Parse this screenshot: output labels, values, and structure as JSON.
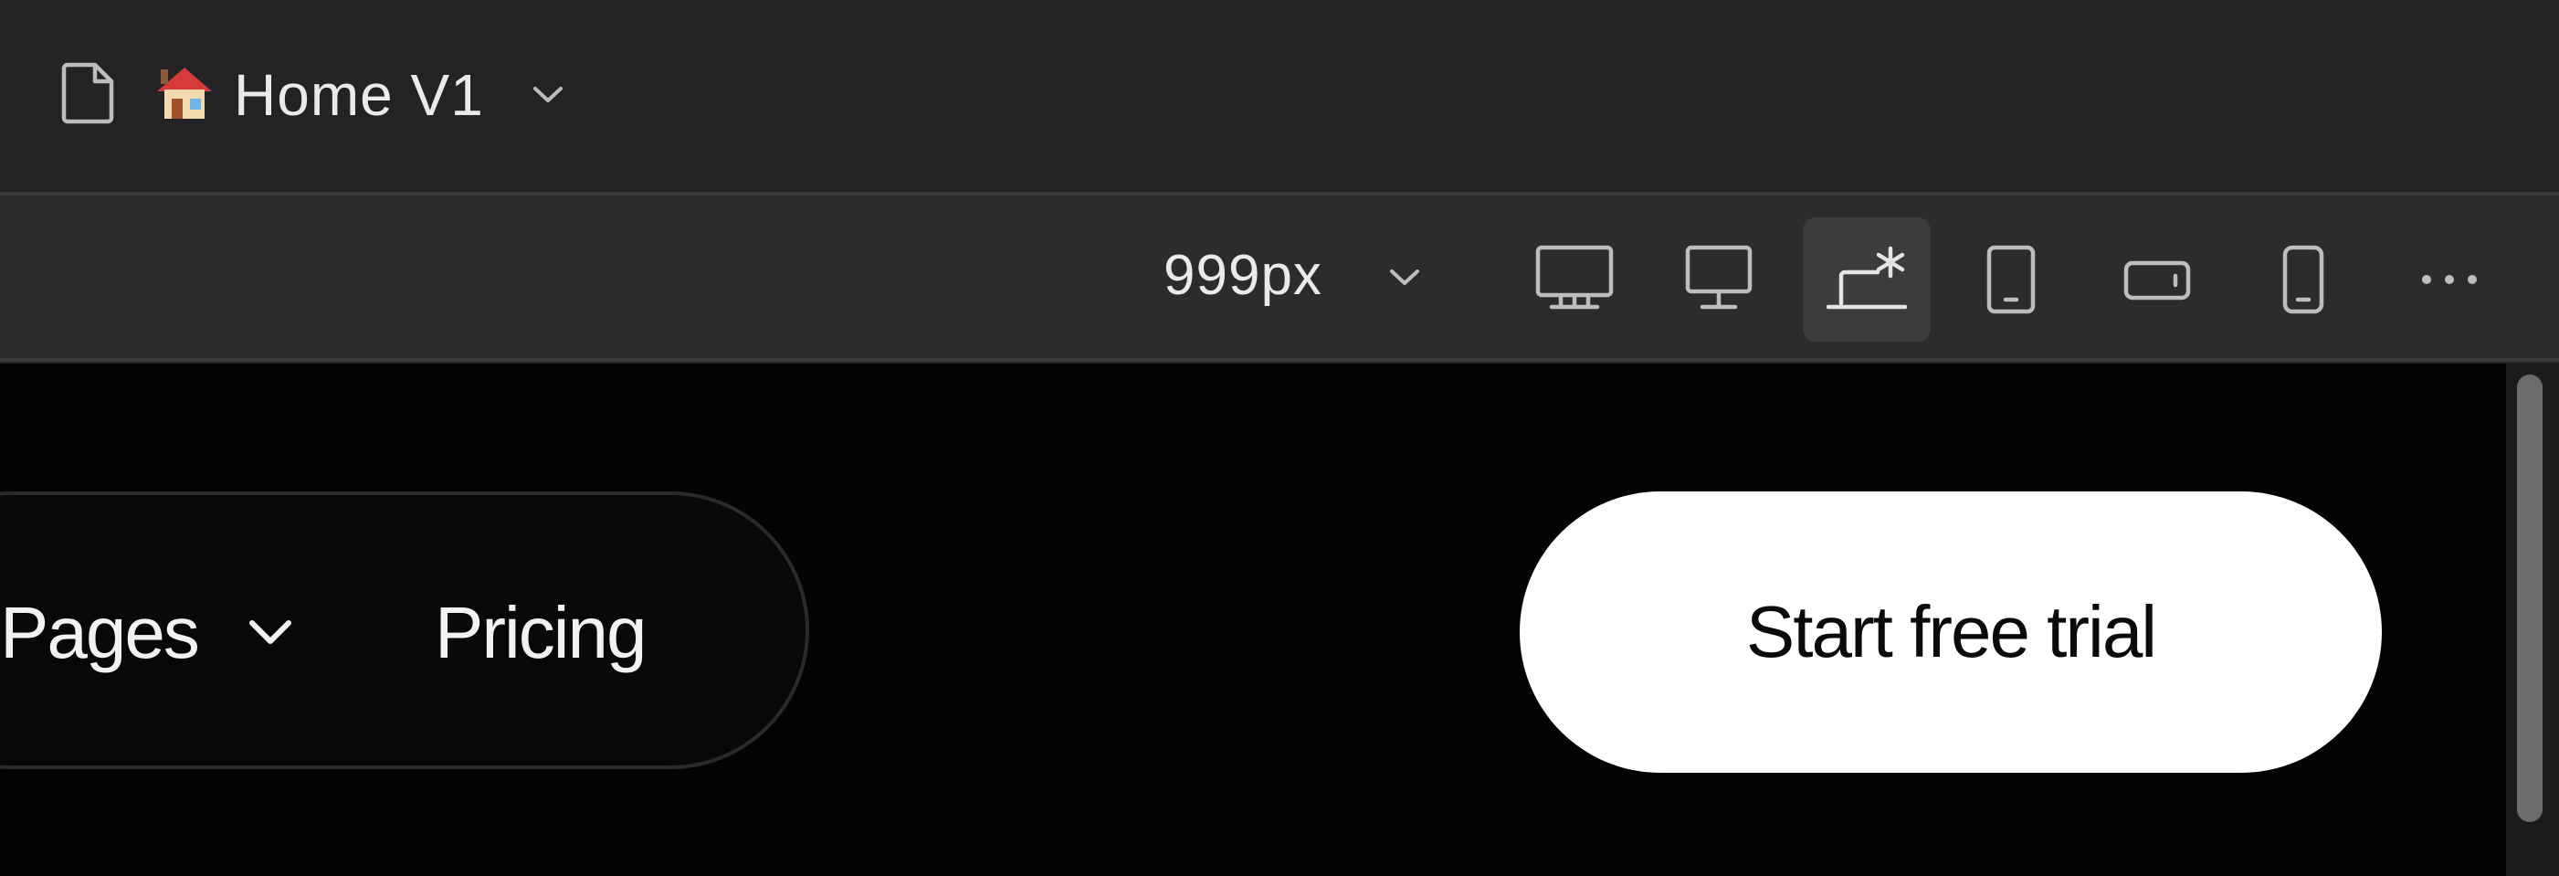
{
  "page_bar": {
    "emoji": "🏠",
    "title": "Home V1",
    "icons": {
      "file": "file-icon",
      "emoji": "house-emoji-icon",
      "dropdown": "chevron-down-icon"
    }
  },
  "toolbar": {
    "width_value": "999px",
    "breakpoints": [
      {
        "icon": "desktop-large-icon",
        "active": false
      },
      {
        "icon": "desktop-icon",
        "active": false
      },
      {
        "icon": "laptop-custom-icon",
        "active": true
      },
      {
        "icon": "tablet-portrait-icon",
        "active": false
      },
      {
        "icon": "tablet-landscape-icon",
        "active": false
      },
      {
        "icon": "phone-icon",
        "active": false
      }
    ],
    "more_icon": "more-horizontal-icon"
  },
  "canvas": {
    "nav": {
      "pages_label": "Pages",
      "pricing_label": "Pricing"
    },
    "cta_label": "Start free trial"
  },
  "colors": {
    "app_bg": "#232325",
    "toolbar_bg": "#2c2c2e",
    "active_button_bg": "#3c3c3f",
    "canvas_bg": "#030305",
    "cta_bg": "#ffffff",
    "cta_text": "#0a0a0c",
    "text": "#eaeaec"
  }
}
